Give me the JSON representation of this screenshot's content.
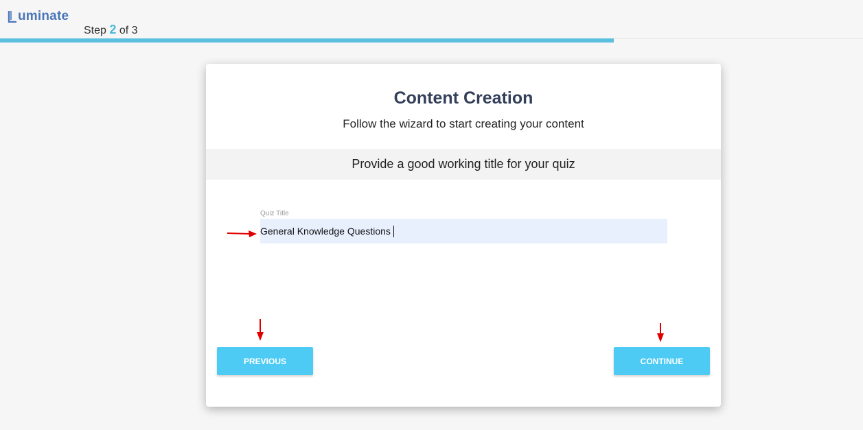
{
  "header": {
    "logo_text": "uminate",
    "logo_initial": "L",
    "step": {
      "prefix": "Step",
      "current": "2",
      "suffix": "of 3"
    },
    "progress_fraction": 0.711
  },
  "card": {
    "title": "Content Creation",
    "subtitle": "Follow the wizard to start creating your content",
    "prompt": "Provide a good working title for your quiz",
    "quiz_title": {
      "label": "Quiz Title",
      "value": "General Knowledge Questions"
    },
    "buttons": {
      "previous": "PREVIOUS",
      "continue": "CONTINUE"
    }
  },
  "colors": {
    "accent": "#5bc0de",
    "button": "#4dcbf5",
    "logo": "#4a76b8",
    "title": "#34405a",
    "input_bg": "#e8f0fe",
    "annotation_arrow": "#e00000"
  },
  "icons": {
    "logo": "luminate-logo-icon",
    "annotation": "red-arrow-icon"
  }
}
